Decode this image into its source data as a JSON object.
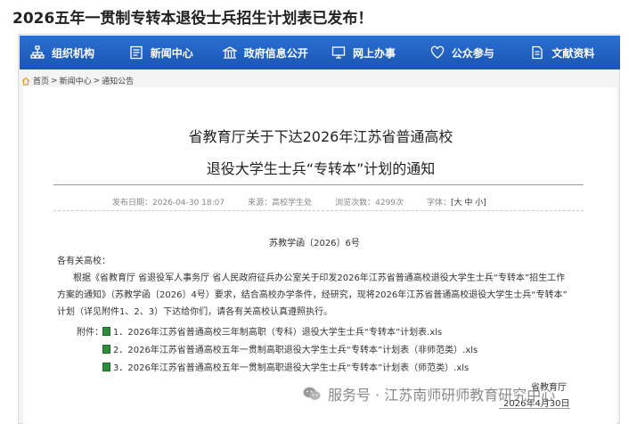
{
  "headline": "2026五年一贯制专转本退役士兵招生计划表已发布！",
  "nav": [
    {
      "label": "组织机构",
      "icon": "org-chart-icon"
    },
    {
      "label": "新闻中心",
      "icon": "news-icon"
    },
    {
      "label": "政府信息公开",
      "icon": "building-icon"
    },
    {
      "label": "网上办事",
      "icon": "monitor-icon"
    },
    {
      "label": "公众参与",
      "icon": "heart-icon"
    },
    {
      "label": "文献资料",
      "icon": "document-icon"
    }
  ],
  "breadcrumb": {
    "home": "首页",
    "sep": ">",
    "news": "新闻中心",
    "notice": "通知公告"
  },
  "doc": {
    "title_line1": "省教育厅关于下达2026年江苏省普通高校",
    "title_line2": "退役大学生士兵“专转本”计划的通知",
    "meta": {
      "date": "发布日期：2026-04-30 18:07",
      "source": "来源：高校学生处",
      "views": "浏览次数：4299次",
      "font_label": "字体：",
      "font_size": "[大 中 小]"
    },
    "doc_number": "苏教学函〔2026〕6号",
    "salutation": "各有关高校：",
    "para_line1": "根据《省教育厅 省退役军人事务厅 省人民政府征兵办公室关于印发2026年江苏省普通高校退役大学生士兵“专转本”招生工作",
    "para_line2": "方案的通知》（苏教学函〔2026〕4号）要求，结合高校办学条件，经研究，现将2026年江苏省普通高校退役大学生士兵“专转本”",
    "para_line3": "计划（详见附件1、2、3）下达给你们，请各有关高校认真遵照执行。",
    "attachments_label": "附件：",
    "attachments": [
      "1．2026年江苏省普通高校三年制高职（专科）退役大学生士兵“专转本”计划表.xls",
      "2．2026年江苏省普通高校五年一贯制高职退役大学生士兵“专转本”计划表（非师范类）.xls",
      "3．2026年江苏省普通高校五年一贯制高职退役大学生士兵“专转本”计划表（师范类）.xls"
    ],
    "signature_org": "省教育厅",
    "signature_date": "2026年4月30日"
  },
  "watermark": "服务号 · 江苏南师研师教育研究中心",
  "colors": {
    "nav_bg": "#1b56b3",
    "xls_icon": "#2e8b3a"
  }
}
